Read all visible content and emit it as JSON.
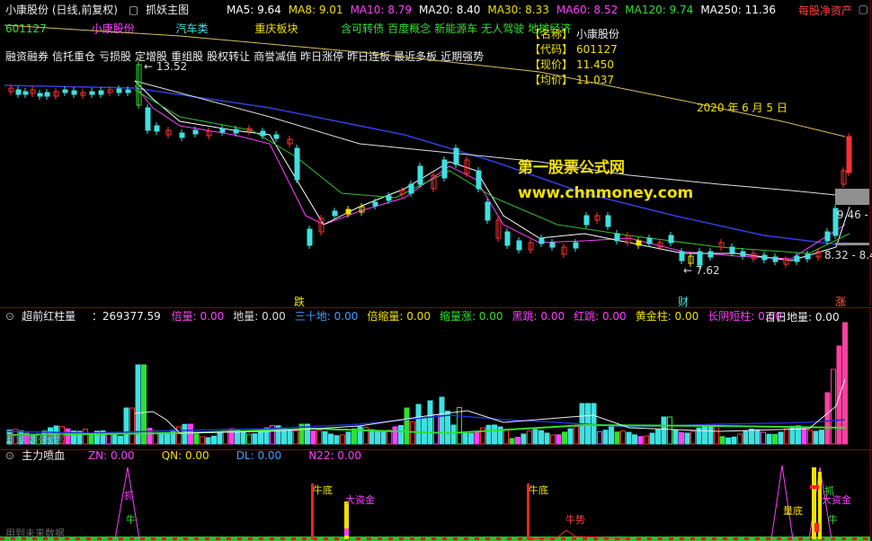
{
  "header": {
    "stock_title": "小康股份 (日线,前复权)",
    "indicator_name": "抓妖主图",
    "ma": [
      {
        "label": "MA5: 9.64",
        "color": "#ffffff"
      },
      {
        "label": "MA8: 9.01",
        "color": "#f0e000"
      },
      {
        "label": "MA10: 8.79",
        "color": "#ff40ff"
      },
      {
        "label": "MA20: 8.40",
        "color": "#ffffff"
      },
      {
        "label": "MA30: 8.33",
        "color": "#f0e000"
      },
      {
        "label": "MA60: 8.52",
        "color": "#ff40ff"
      },
      {
        "label": "MA120: 9.74",
        "color": "#30e030"
      },
      {
        "label": "MA250: 11.36",
        "color": "#ffffff"
      }
    ],
    "right_link": "每股净资产",
    "close_glyph": "▢"
  },
  "row2": {
    "code": "601127",
    "name": "小康股份",
    "industry": "汽车类",
    "region": "重庆板块",
    "concepts": [
      "含可转债",
      "百度概念",
      "新能源车",
      "无人驾驶",
      "地摊经济"
    ]
  },
  "row3": {
    "tags": [
      "融资融券",
      "信托重仓",
      "亏损股",
      "定增股",
      "重组股",
      "股权转让",
      "商誉减值",
      "昨日涨停",
      "昨日连板",
      "最近多板",
      "近期强势"
    ]
  },
  "info": {
    "rows": [
      {
        "k": "【名称】",
        "v": "小康股份"
      },
      {
        "k": "【代码】",
        "v": "601127"
      },
      {
        "k": "【现价】",
        "v": "11.450"
      },
      {
        "k": "【均价】",
        "v": "11.037"
      }
    ]
  },
  "chart": {
    "date_label": "2020 年 6 月 5 日",
    "watermark_cn": "第一股票公式网",
    "watermark_url": "www.chnmoney.com",
    "high_label": "13.52",
    "low_label": "7.62",
    "right_price_1": "9.46 -",
    "right_price_2": "8.32 - 8.4",
    "marker_1": "跌",
    "marker_2": "财",
    "marker_3": "涨"
  },
  "volume": {
    "title": "超前红柱量",
    "value": "：269377.59",
    "items": [
      {
        "label": "倍量: 0.00",
        "color": "#ff40ff"
      },
      {
        "label": "地量: 0.00",
        "color": "#dddddd"
      },
      {
        "label": "三十地: 0.00",
        "color": "#40a0ff"
      },
      {
        "label": "倍缩量: 0.00",
        "color": "#f0e000"
      },
      {
        "label": "缩量涨: 0.00",
        "color": "#30e030"
      },
      {
        "label": "黑跳: 0.00",
        "color": "#ff40ff"
      },
      {
        "label": "红跳: 0.00",
        "color": "#ff40ff"
      },
      {
        "label": "黄金柱: 0.00",
        "color": "#f0e000"
      },
      {
        "label": "长阴短柱: 0.00",
        "color": "#ff40ff"
      }
    ],
    "hundred_day": "百日地量: 0.00",
    "bottom_text": "用到未来数据"
  },
  "bottom_panel": {
    "title": "主力喷血",
    "items": [
      {
        "label": "ZN: 0.00",
        "color": "#ff40ff"
      },
      {
        "label": "QN: 0.00",
        "color": "#f0e000"
      },
      {
        "label": "DL: 0.00",
        "color": "#40a0ff"
      },
      {
        "label": "N22: 0.00",
        "color": "#ff40ff"
      }
    ],
    "labels": {
      "zhua_1": "抓",
      "niu_1": "牛",
      "niudi_1": "牛底",
      "dazijin_1": "大资金",
      "niudi_2": "牛底",
      "niushi": "牛势",
      "liangdi": "量底",
      "zhua_2": "抓",
      "dazijin_2": "大资金",
      "niu_2": "牛"
    },
    "bottom_text": "用到未来数据"
  }
}
